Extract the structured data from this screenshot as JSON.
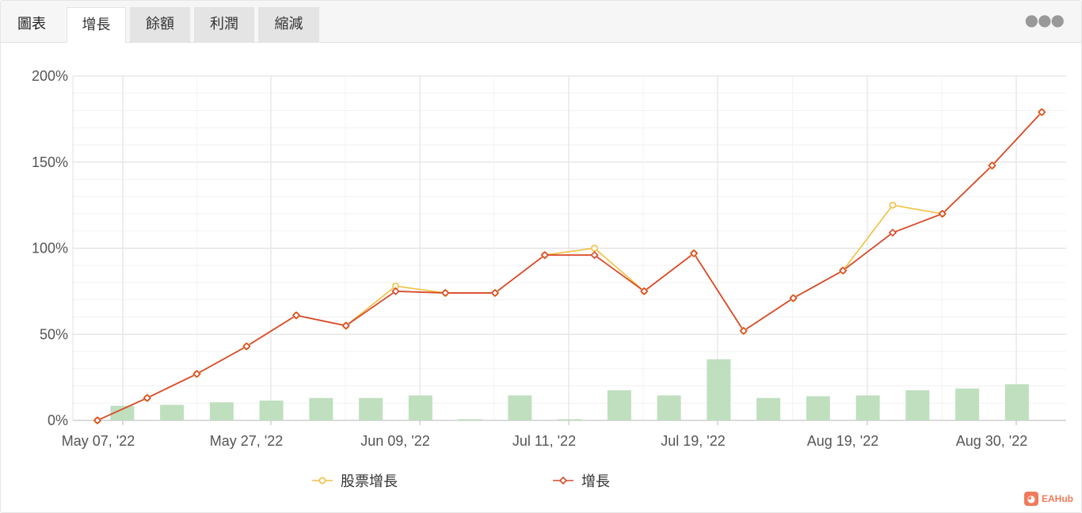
{
  "tabs": {
    "title": "圖表",
    "items": [
      "增長",
      "餘額",
      "利潤",
      "縮減"
    ],
    "active": 0
  },
  "chart_data": {
    "type": "line",
    "x_tick_labels": [
      "May 07, '22",
      "May 27, '22",
      "Jun 09, '22",
      "Jul 11, '22",
      "Jul 19, '22",
      "Aug 19, '22",
      "Aug 30, '22"
    ],
    "y_ticks": [
      "0%",
      "50%",
      "100%",
      "150%",
      "200%"
    ],
    "ylim": [
      0,
      200
    ],
    "grid": true,
    "legend_position": "bottom",
    "series": [
      {
        "name": "股票增長",
        "type": "line",
        "color": "#f0c040",
        "marker": "circle",
        "values": [
          0,
          13,
          27,
          43,
          61,
          55,
          78,
          74,
          74,
          96,
          100,
          75,
          97,
          52,
          71,
          87,
          125,
          120,
          148,
          179
        ]
      },
      {
        "name": "增長",
        "type": "line",
        "color": "#d84a2a",
        "marker": "diamond",
        "values": [
          0,
          13,
          27,
          43,
          61,
          55,
          75,
          74,
          74,
          96,
          96,
          75,
          97,
          52,
          71,
          87,
          109,
          120,
          148,
          179
        ]
      },
      {
        "type": "bar",
        "color": "#bfdfbf",
        "values": [
          8.5,
          9,
          10.5,
          11.5,
          13,
          13,
          14.5,
          0.7,
          14.5,
          0.7,
          17.5,
          14.5,
          35.5,
          13,
          14,
          14.5,
          17.5,
          18.5,
          21
        ]
      }
    ]
  },
  "brand": {
    "icon": "piggy-icon",
    "text": "EAHub"
  }
}
